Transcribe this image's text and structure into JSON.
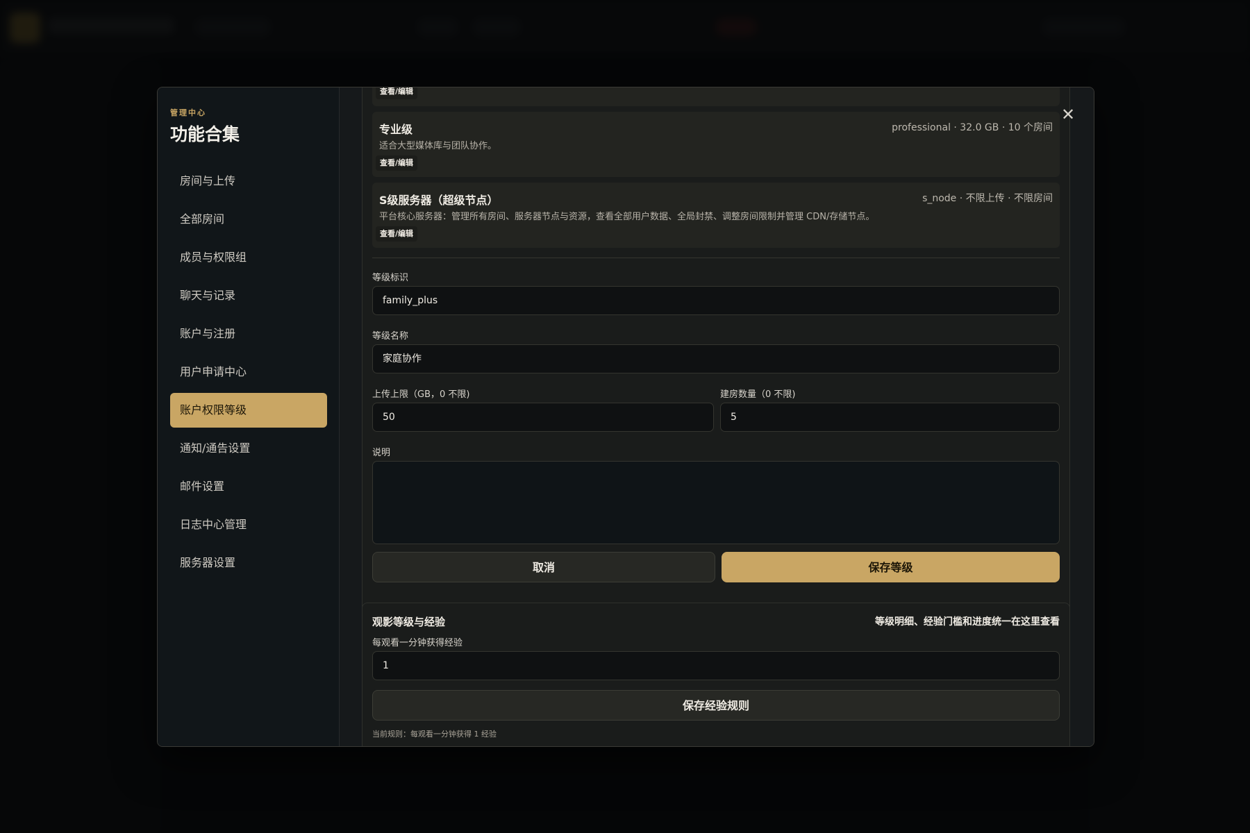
{
  "modal": {
    "kicker": "管理中心",
    "title": "功能合集",
    "close_glyph": "✕"
  },
  "sidebar": {
    "items": [
      {
        "label": "房间与上传"
      },
      {
        "label": "全部房间"
      },
      {
        "label": "成员与权限组"
      },
      {
        "label": "聊天与记录"
      },
      {
        "label": "账户与注册"
      },
      {
        "label": "用户申请中心"
      },
      {
        "label": "账户权限等级",
        "active": true
      },
      {
        "label": "通知/通告设置"
      },
      {
        "label": "邮件设置"
      },
      {
        "label": "日志中心管理"
      },
      {
        "label": "服务器设置"
      }
    ]
  },
  "tiers": {
    "partial": {
      "button": "查看/编辑"
    },
    "professional": {
      "name": "专业级",
      "meta": "professional · 32.0 GB · 10 个房间",
      "desc": "适合大型媒体库与团队协作。",
      "button": "查看/编辑"
    },
    "s_node": {
      "name": "S级服务器（超级节点）",
      "meta": "s_node · 不限上传 · 不限房间",
      "desc": "平台核心服务器：管理所有房间、服务器节点与资源，查看全部用户数据、全局封禁、调整房间限制并管理 CDN/存储节点。",
      "button": "查看/编辑"
    }
  },
  "form": {
    "id_label": "等级标识",
    "id_value": "family_plus",
    "name_label": "等级名称",
    "name_value": "家庭协作",
    "upload_label": "上传上限（GB，0 不限)",
    "upload_value": "50",
    "rooms_label": "建房数量（0 不限)",
    "rooms_value": "5",
    "desc_label": "说明",
    "desc_value": "",
    "cancel_label": "取消",
    "save_label": "保存等级"
  },
  "exp": {
    "title": "观影等级与经验",
    "note": "等级明细、经验门槛和进度统一在这里查看",
    "field_label": "每观看一分钟获得经验",
    "field_value": "1",
    "save_label": "保存经验规则",
    "current_rule": "当前规则：每观看一分钟获得 1 经验"
  },
  "colors": {
    "accent": "#c9a664",
    "background": "#16191b",
    "sidebar": "#111619"
  }
}
